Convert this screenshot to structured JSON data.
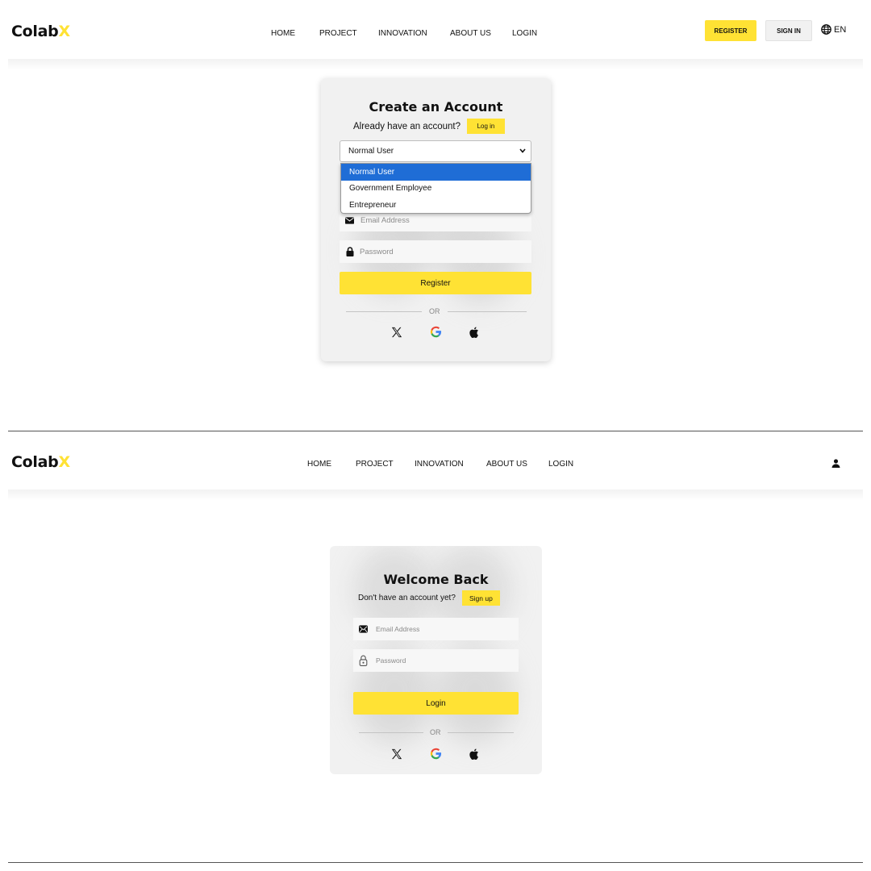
{
  "screen1": {
    "logo": {
      "main": "Colab",
      "accent": "X"
    },
    "nav": [
      "HOME",
      "PROJECT",
      "INNOVATION",
      "ABOUT US",
      "LOGIN"
    ],
    "register_button": "REGISTER",
    "signin_button": "SIGN IN",
    "language": {
      "icon": "globe-icon",
      "label": "EN"
    },
    "card": {
      "title": "Create an Account",
      "prompt": "Already have an account?",
      "login_link": "Log in",
      "user_type_select": {
        "value": "Normal User",
        "options": [
          "Normal User",
          "Government Employee",
          "Entrepreneur"
        ],
        "selected_index": 0
      },
      "email_placeholder": "Email Address",
      "password_placeholder": "Password",
      "submit": "Register",
      "or_label": "OR",
      "social": [
        "x-icon",
        "google-icon",
        "apple-icon"
      ]
    }
  },
  "screen2": {
    "logo": {
      "main": "Colab",
      "accent": "X"
    },
    "nav": [
      "HOME",
      "PROJECT",
      "INNOVATION",
      "ABOUT US",
      "LOGIN"
    ],
    "user_icon": "user-icon",
    "card": {
      "title": "Welcome Back",
      "prompt": "Don't have an account yet?",
      "signup_link": "Sign up",
      "email_placeholder": "Email Address",
      "password_placeholder": "Password",
      "submit": "Login",
      "or_label": "OR",
      "social": [
        "x-icon",
        "google-icon",
        "apple-icon"
      ]
    }
  },
  "colors": {
    "accent": "#ffe234",
    "select_highlight": "#1f6dd6",
    "card_bg": "#f1f1f1"
  }
}
